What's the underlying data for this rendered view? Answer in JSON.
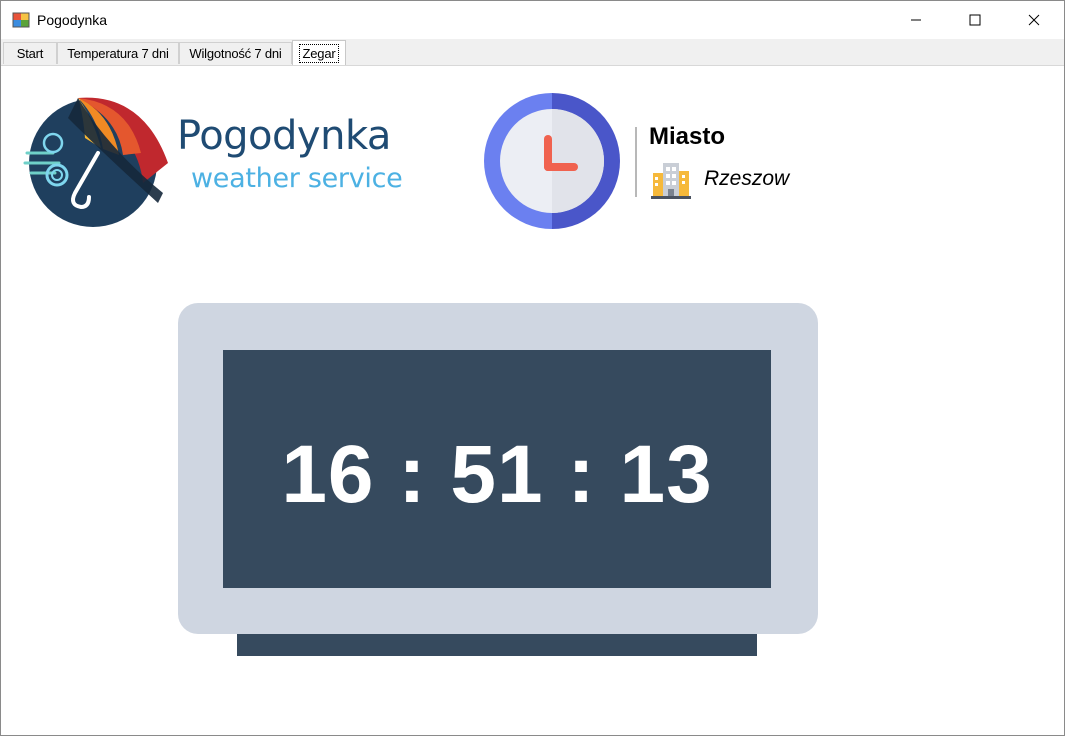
{
  "window": {
    "title": "Pogodynka",
    "icon": "app-window-icon",
    "controls": [
      "minimize-icon",
      "maximize-icon",
      "close-icon"
    ]
  },
  "tabs": [
    {
      "label": "Start",
      "active": false
    },
    {
      "label": "Temperatura 7 dni",
      "active": false
    },
    {
      "label": "Wilgotność 7 dni",
      "active": false
    },
    {
      "label": "Zegar",
      "active": true
    }
  ],
  "logo": {
    "title": "Pogodynka",
    "subtitle": "weather service",
    "icon": "umbrella-wind-icon",
    "colors": {
      "title": "#1f4b73",
      "subtitle": "#4cb1e3"
    }
  },
  "city": {
    "label": "Miasto",
    "name": "Rzeszow",
    "icon": "building-icon",
    "clock_icon": "clock-icon"
  },
  "clock": {
    "time": "16 : 51 : 13",
    "colors": {
      "frame": "#cfd6e1",
      "screen": "#364a5e",
      "digits": "#ffffff"
    }
  }
}
